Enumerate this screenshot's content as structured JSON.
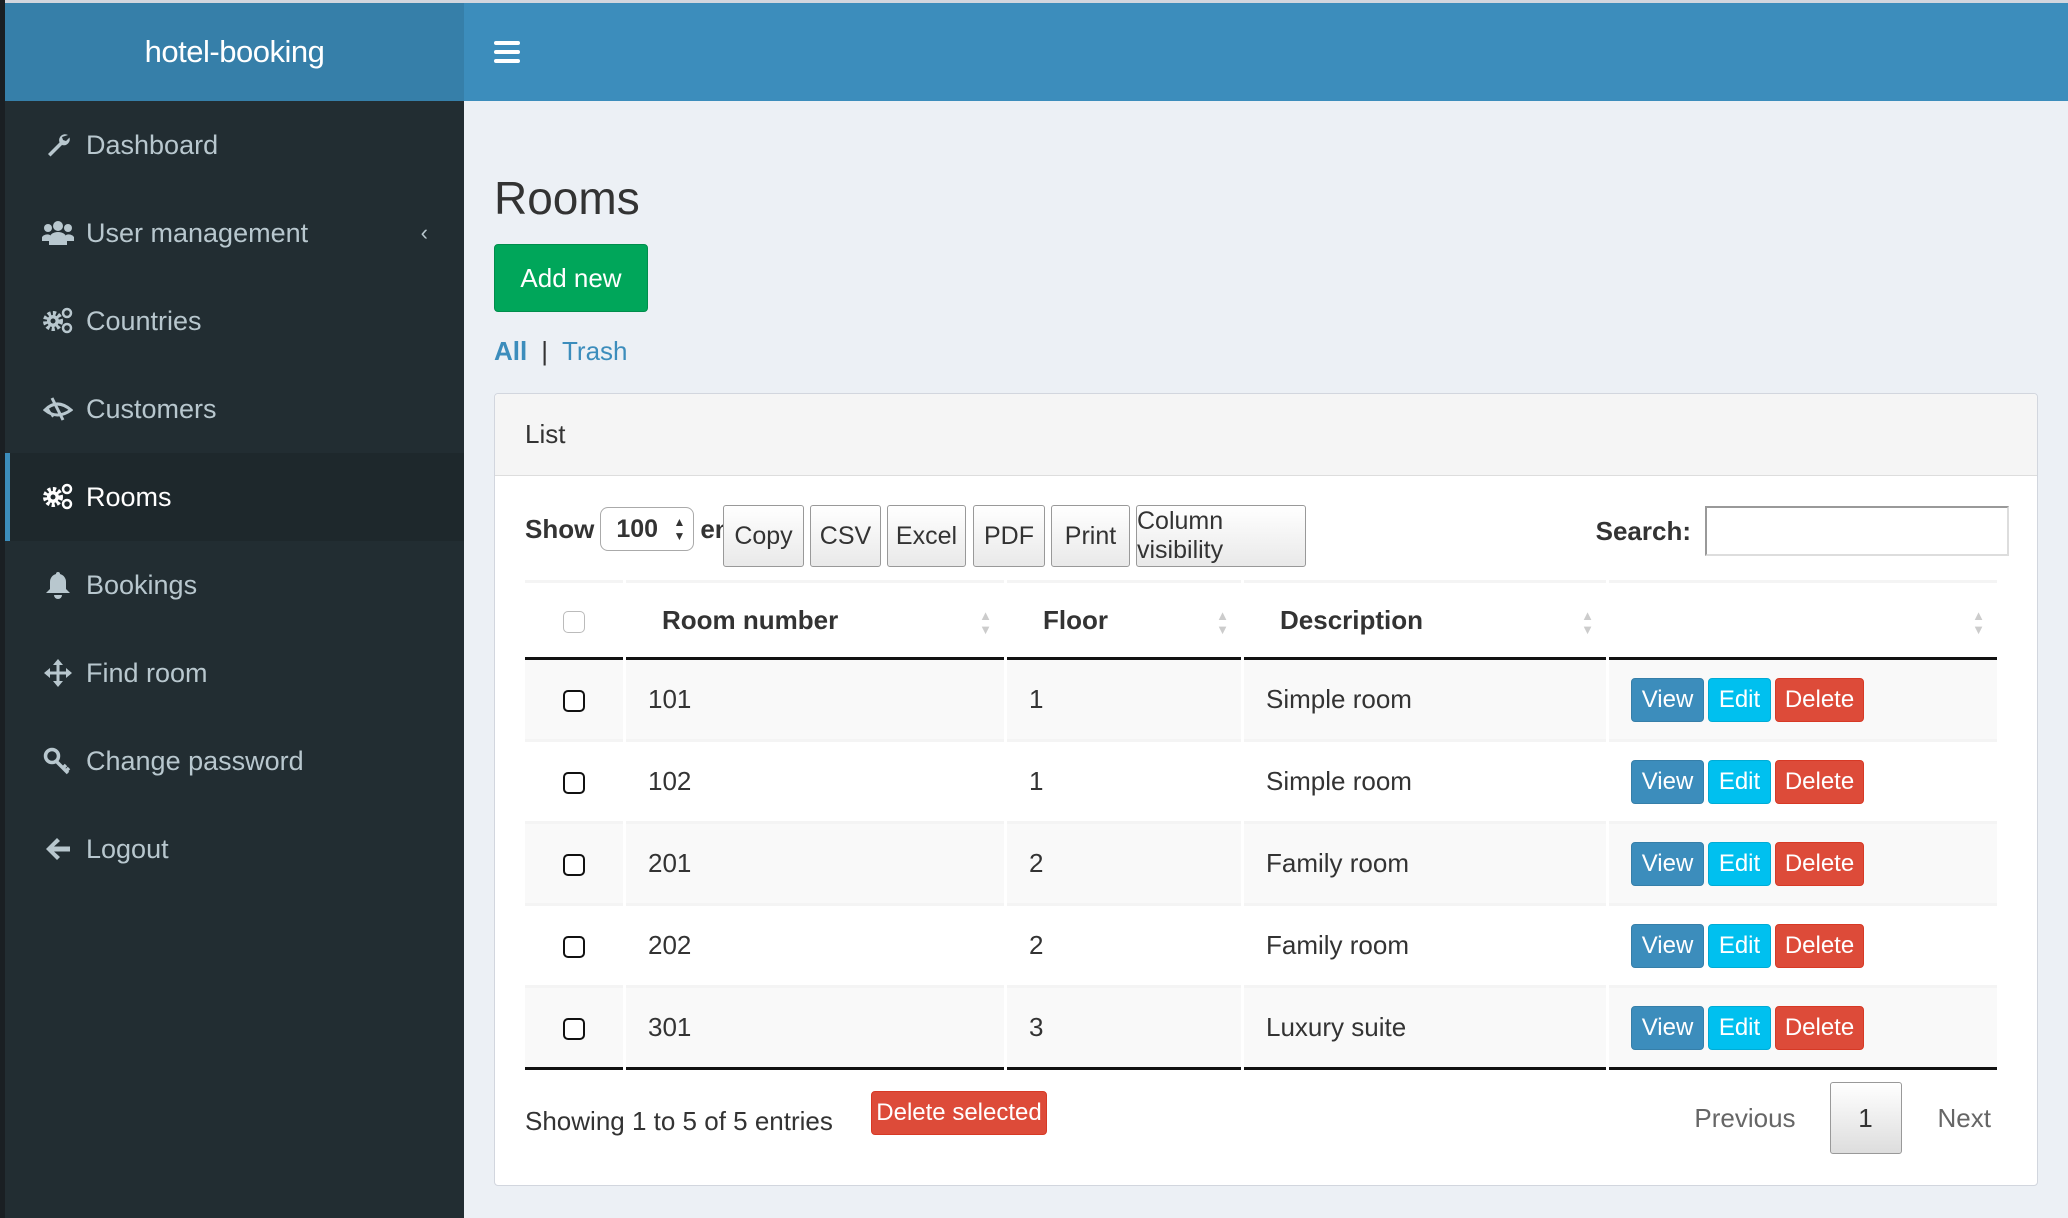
{
  "app": {
    "title": "hotel-booking"
  },
  "colors": {
    "primary": "#3c8dbc",
    "success": "#00a65a",
    "info": "#00c0ef",
    "danger": "#dd4b39",
    "sidebar": "#222d32"
  },
  "sidebar": {
    "items": [
      {
        "label": "Dashboard",
        "icon": "wrench-icon"
      },
      {
        "label": "User management",
        "icon": "users-icon",
        "has_submenu": true
      },
      {
        "label": "Countries",
        "icon": "cogs-icon"
      },
      {
        "label": "Customers",
        "icon": "low-vision-icon"
      },
      {
        "label": "Rooms",
        "icon": "cogs-icon",
        "active": true
      },
      {
        "label": "Bookings",
        "icon": "bell-icon"
      },
      {
        "label": "Find room",
        "icon": "arrows-icon"
      },
      {
        "label": "Change password",
        "icon": "key-icon"
      },
      {
        "label": "Logout",
        "icon": "arrow-left-icon"
      }
    ]
  },
  "page": {
    "title": "Rooms",
    "add_new_label": "Add new",
    "filter_all": "All",
    "filter_sep": "|",
    "filter_trash": "Trash"
  },
  "panel": {
    "title": "List",
    "length": {
      "show": "Show",
      "value": "100",
      "entries": "entries"
    },
    "buttons": [
      "Copy",
      "CSV",
      "Excel",
      "PDF",
      "Print",
      "Column visibility"
    ],
    "search_label": "Search:",
    "search_value": "",
    "columns": [
      "",
      "Room number",
      "Floor",
      "Description",
      ""
    ],
    "rows": [
      {
        "room_number": "101",
        "floor": "1",
        "description": "Simple room"
      },
      {
        "room_number": "102",
        "floor": "1",
        "description": "Simple room"
      },
      {
        "room_number": "201",
        "floor": "2",
        "description": "Family room"
      },
      {
        "room_number": "202",
        "floor": "2",
        "description": "Family room"
      },
      {
        "room_number": "301",
        "floor": "3",
        "description": "Luxury suite"
      }
    ],
    "row_actions": {
      "view": "View",
      "edit": "Edit",
      "delete": "Delete"
    },
    "info": "Showing 1 to 5 of 5 entries",
    "delete_selected_label": "Delete selected",
    "pagination": {
      "previous": "Previous",
      "current": "1",
      "next": "Next"
    }
  }
}
